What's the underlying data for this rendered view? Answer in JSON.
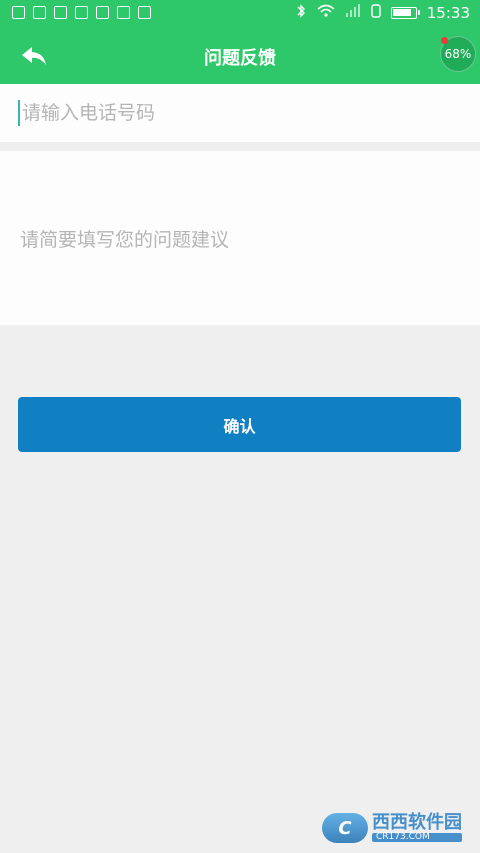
{
  "status_bar": {
    "time": "15:33",
    "battery_level": 0.9
  },
  "header": {
    "title": "问题反馈",
    "badge": "68%"
  },
  "form": {
    "phone_placeholder": "请输入电话号码",
    "feedback_placeholder": "请简要填写您的问题建议",
    "confirm_label": "确认"
  },
  "watermark": {
    "brand": "西西软件园",
    "url": "CR173.COM"
  },
  "colors": {
    "primary_green": "#2ec76a",
    "button_blue": "#1180c3",
    "background": "#efefef"
  }
}
